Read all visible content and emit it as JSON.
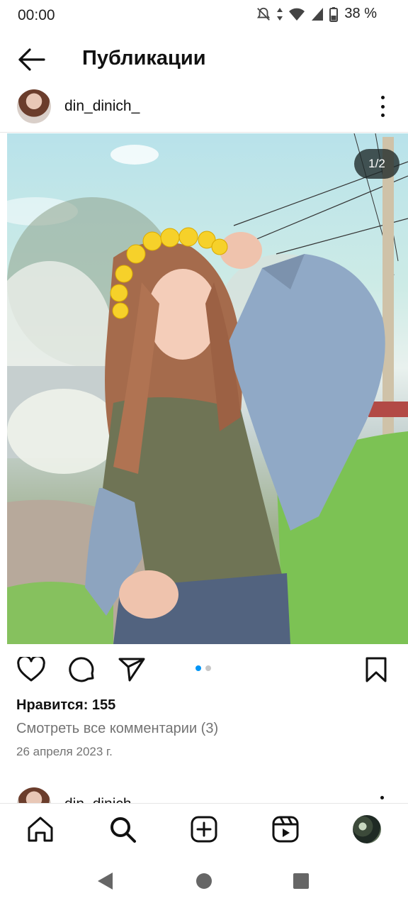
{
  "status": {
    "time": "00:00",
    "battery": "38 %"
  },
  "header": {
    "title": "Публикации"
  },
  "post": {
    "username": "din_dinich_",
    "counter": "1/2",
    "likes": "Нравится: 155",
    "comments_link": "Смотреть все комментарии (3)",
    "date": "26 апреля 2023 г.",
    "carousel": {
      "total": 2,
      "active": 1
    }
  },
  "next_post": {
    "username": "din_dinich_"
  },
  "icons": {
    "back": "arrow-left-icon",
    "more": "more-vertical-icon",
    "like": "heart-icon",
    "comment": "comment-icon",
    "share": "send-icon",
    "save": "bookmark-icon",
    "home": "home-icon",
    "search": "search-icon",
    "create": "plus-square-icon",
    "reels": "reels-icon",
    "profile": "avatar",
    "sys_back": "triangle-back-icon",
    "sys_home": "circle-home-icon",
    "sys_recents": "square-recents-icon"
  },
  "colors": {
    "accent": "#0095f6",
    "text": "#111111",
    "muted": "#737373"
  }
}
